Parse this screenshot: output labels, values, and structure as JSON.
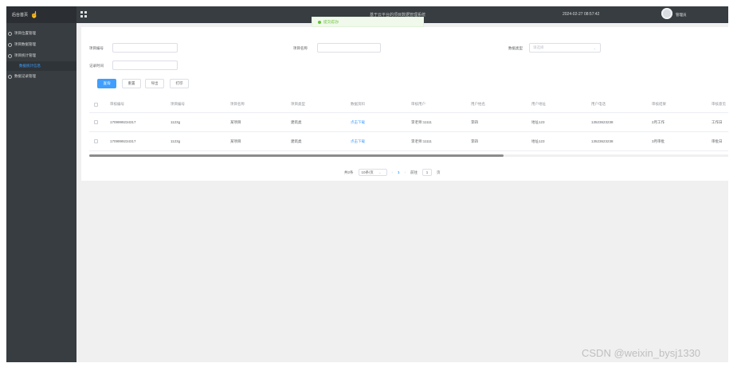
{
  "sidebar": {
    "brand": "后台首页",
    "items": [
      {
        "label": "项目位置管理"
      },
      {
        "label": "项目数据管理"
      },
      {
        "label": "项目统计管理"
      },
      {
        "label": "数据记录管理"
      }
    ],
    "sub_item": "数据统计信息"
  },
  "header": {
    "title": "基于云平台的项目数据管理系统",
    "datetime": "2024-02-27 08:57:42",
    "username": "管理员"
  },
  "toast": {
    "text": "提交成功!"
  },
  "filters": {
    "project_no_label": "项目编号",
    "project_name_label": "项目名称",
    "type_label": "数据类型",
    "type_placeholder": "请选择",
    "record_no_label": "记录时间"
  },
  "actions": {
    "search": "查询",
    "reset": "重置",
    "export": "导出",
    "print": "打印"
  },
  "table": {
    "headers": [
      "审核编号",
      "项目编号",
      "项目名称",
      "项目类型",
      "数据资料",
      "审核用户",
      "用户姓名",
      "用户地址",
      "用户电话",
      "审核结果",
      "审核意见"
    ],
    "rows": [
      [
        "1709999234317",
        "1123g",
        "某项目",
        "建筑类",
        "点击下载",
        "李老师:11111",
        "李四",
        "地址123",
        "13523623238",
        "2月工作",
        "工作日"
      ],
      [
        "1709999234317",
        "1123g",
        "某项目",
        "建筑类",
        "点击下载",
        "李老师:11111",
        "李四",
        "地址123",
        "13523623238",
        "3月审批",
        "审批日"
      ]
    ]
  },
  "pagination": {
    "total": "共2条",
    "page_size": "10条/页",
    "current_page": "1",
    "goto_label": "前往",
    "goto_value": "1",
    "page_unit": "页"
  },
  "watermark": "CSDN @weixin_bysj1330"
}
